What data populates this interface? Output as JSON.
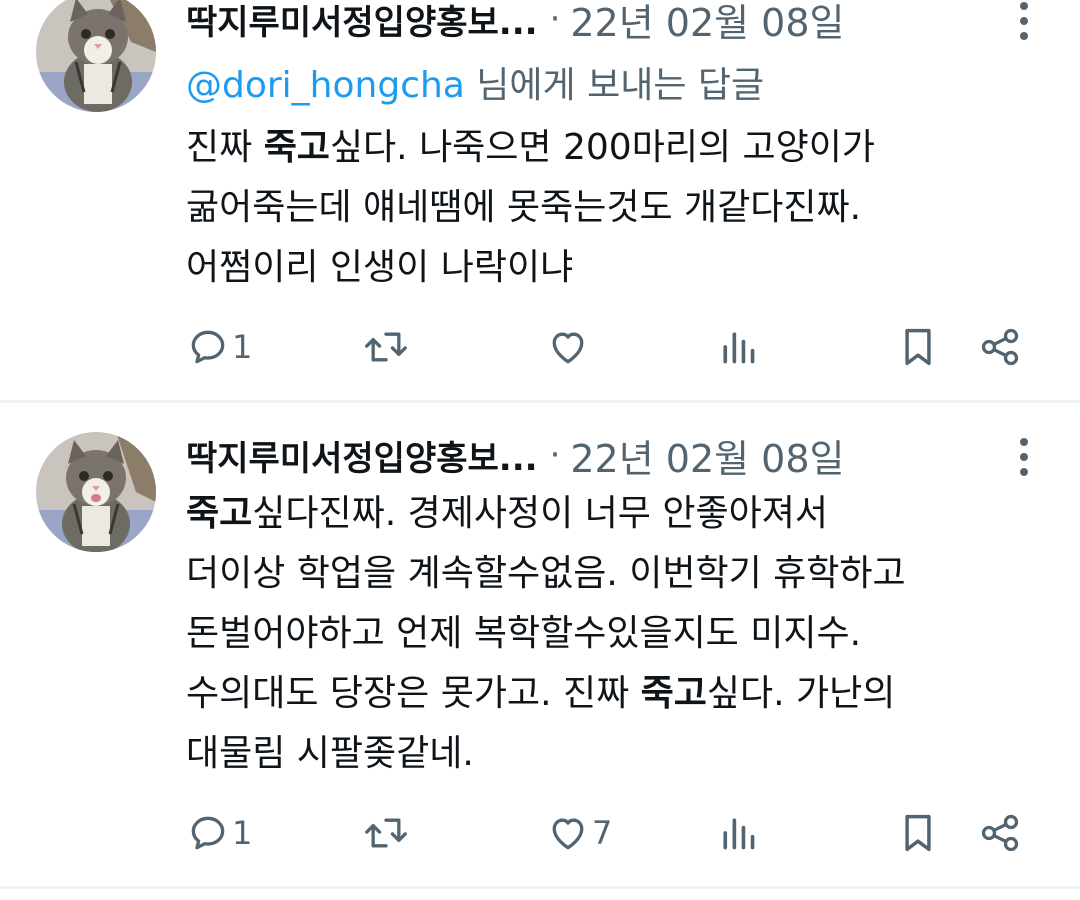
{
  "tweets": [
    {
      "author": "딱지루미서정입양홍보...",
      "separator": "·",
      "date": "22년 02월 08일",
      "reply_to": {
        "handle": "@dori_hongcha",
        "suffix": " 님에게 보내는 답글"
      },
      "lines": [
        [
          {
            "text": "진짜 ",
            "bold": false
          },
          {
            "text": "죽고",
            "bold": true
          },
          {
            "text": "싶다. 나죽으면 200마리의 고양이가",
            "bold": false
          }
        ],
        [
          {
            "text": "굶어죽는데 얘네땜에 못죽는것도 개같다진짜.",
            "bold": false
          }
        ],
        [
          {
            "text": "어쩜이리 인생이 나락이냐",
            "bold": false
          }
        ]
      ],
      "actions": {
        "reply_count": "1",
        "retweet_count": "",
        "like_count": ""
      }
    },
    {
      "author": "딱지루미서정입양홍보...",
      "separator": "·",
      "date": "22년 02월 08일",
      "lines": [
        [
          {
            "text": "죽고",
            "bold": true
          },
          {
            "text": "싶다진짜. 경제사정이 너무 안좋아져서",
            "bold": false
          }
        ],
        [
          {
            "text": "더이상 학업을 계속할수없음. 이번학기 휴학하고",
            "bold": false
          }
        ],
        [
          {
            "text": "돈벌어야하고 언제 복학할수있을지도 미지수.",
            "bold": false
          }
        ],
        [
          {
            "text": "수의대도 당장은 못가고. 진짜 ",
            "bold": false
          },
          {
            "text": "죽고",
            "bold": true
          },
          {
            "text": "싶다. 가난의",
            "bold": false
          }
        ],
        [
          {
            "text": "대물림 시팔좆같네.",
            "bold": false
          }
        ]
      ],
      "actions": {
        "reply_count": "1",
        "retweet_count": "",
        "like_count": "7"
      }
    }
  ],
  "icons": {
    "reply": "reply-icon",
    "retweet": "retweet-icon",
    "like": "heart-icon",
    "views": "views-icon",
    "bookmark": "bookmark-icon",
    "share": "share-icon",
    "more": "more-vertical-icon"
  },
  "colors": {
    "text": "#0f1419",
    "secondary": "#536471",
    "link": "#1d9bf0",
    "divider": "#eff3f4"
  }
}
